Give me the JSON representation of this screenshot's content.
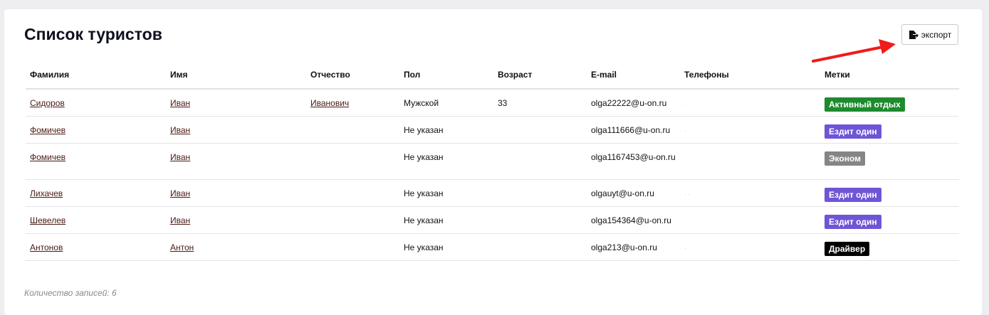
{
  "page": {
    "title": "Список туристов",
    "export_label": "экспорт",
    "footer": "Количество записей: 6"
  },
  "table": {
    "headers": [
      "Фамилия",
      "Имя",
      "Отчество",
      "Пол",
      "Возраст",
      "E-mail",
      "Телефоны",
      "Метки"
    ],
    "rows": [
      {
        "surname": "Сидоров",
        "name": "Иван",
        "patronymic": "Иванович",
        "gender": "Мужской",
        "age": "33",
        "email": "olga22222@u-on.ru",
        "phones": "·",
        "tag": "Активный отдых",
        "tag_color": "#1e8a2e"
      },
      {
        "surname": "Фомичев",
        "name": "Иван",
        "patronymic": "",
        "gender": "Не указан",
        "age": "",
        "email": "olga111666@u-on.ru",
        "phones": "·",
        "tag": "Ездит один",
        "tag_color": "#6f55d6"
      },
      {
        "surname": "Фомичев",
        "name": "Иван",
        "patronymic": "",
        "gender": "Не указан",
        "age": "",
        "email": "olga1167453@u-on.ru",
        "phones": "",
        "tag": "Эконом",
        "tag_color": "#858585"
      },
      {
        "surname": "Лихачев",
        "name": "Иван",
        "patronymic": "",
        "gender": "Не указан",
        "age": "",
        "email": "olgauyt@u-on.ru",
        "phones": "· ·",
        "tag": "Ездит один",
        "tag_color": "#6f55d6"
      },
      {
        "surname": "Шевелев",
        "name": "Иван",
        "patronymic": "",
        "gender": "Не указан",
        "age": "",
        "email": "olga154364@u-on.ru",
        "phones": "",
        "tag": "Ездит один",
        "tag_color": "#6f55d6"
      },
      {
        "surname": "Антонов",
        "name": "Антон",
        "patronymic": "",
        "gender": "Не указан",
        "age": "",
        "email": "olga213@u-on.ru",
        "phones": "·",
        "tag": "Драйвер",
        "tag_color": "#000000"
      }
    ]
  },
  "colors": {
    "arrow": "#ee1c1c"
  }
}
